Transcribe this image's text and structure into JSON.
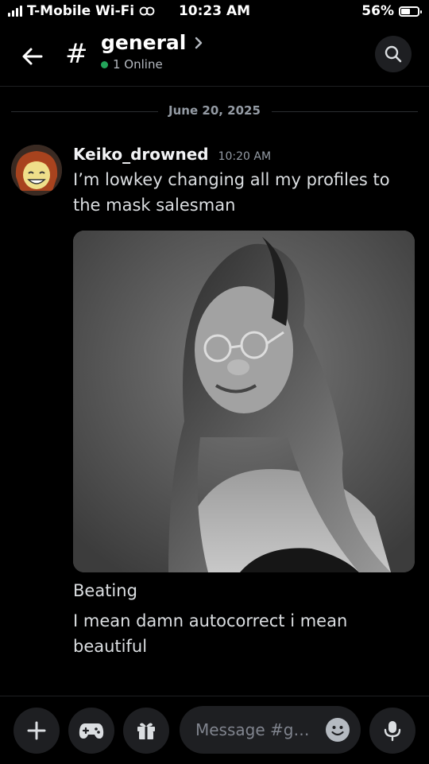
{
  "status_bar": {
    "carrier": "T-Mobile Wi-Fi",
    "time": "10:23 AM",
    "battery_percent_label": "56%",
    "battery_level": 0.56
  },
  "header": {
    "channel_name": "general",
    "online_status": "1 Online"
  },
  "divider": {
    "date": "June 20, 2025"
  },
  "message": {
    "username": "Keiko_drowned",
    "timestamp": "10:20 AM",
    "text": "I’m lowkey changing all my profiles to the mask salesman"
  },
  "followups": [
    {
      "text": "Beating"
    },
    {
      "text": "I mean damn autocorrect i mean beautiful"
    }
  ],
  "composer": {
    "placeholder": "Message #ge…"
  },
  "colors": {
    "online": "#23a55a",
    "background": "#000000",
    "surface": "#1e1f22"
  }
}
